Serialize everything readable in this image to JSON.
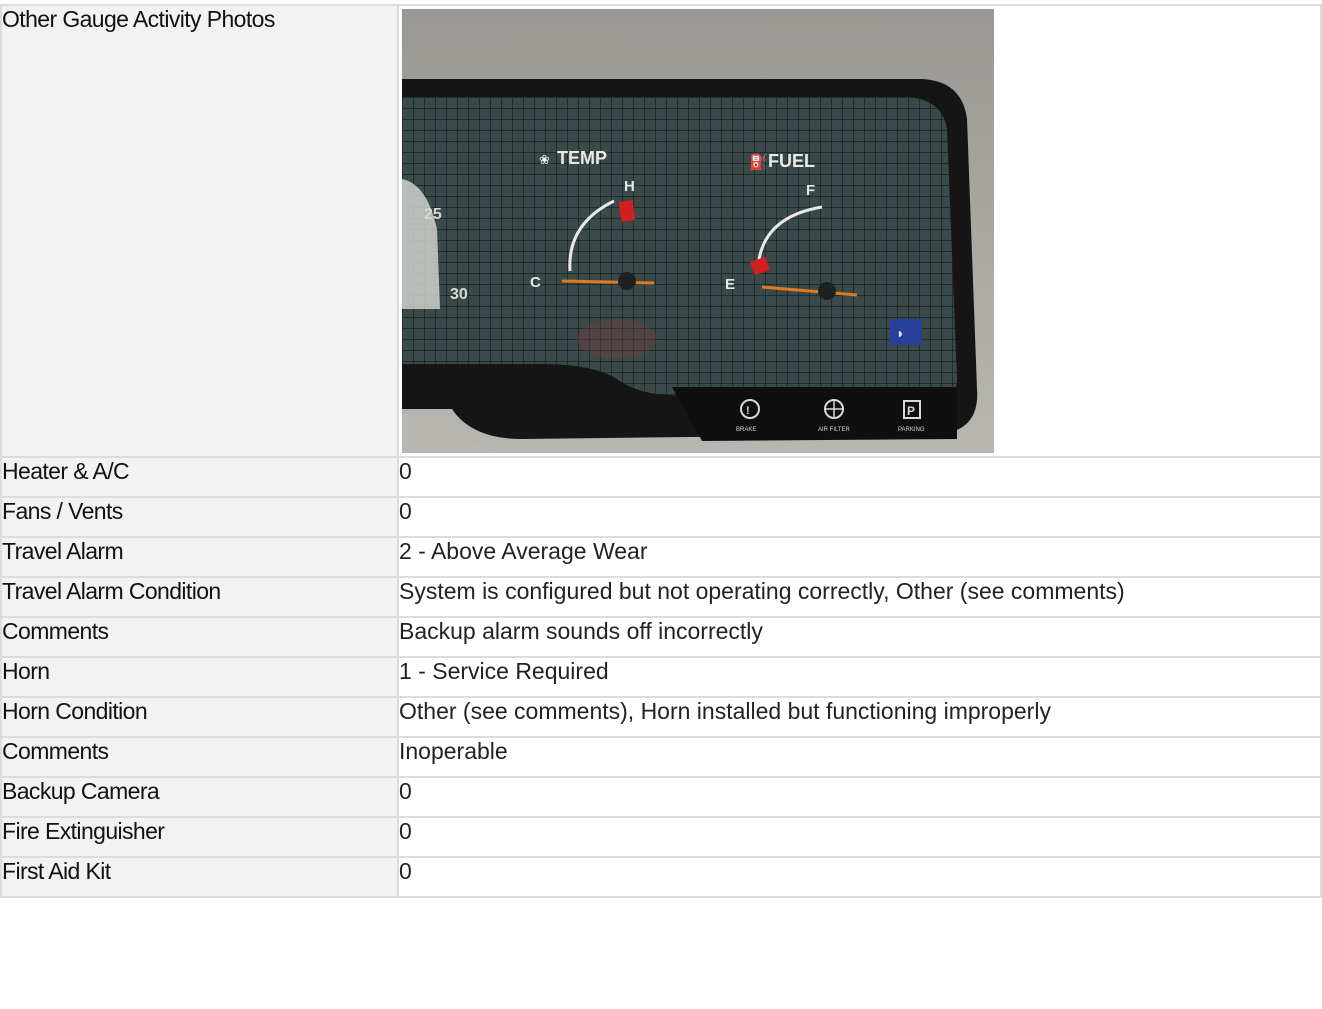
{
  "photo_row": {
    "label": "Other Gauge Activity Photos",
    "photo": {
      "icon_names": [
        "temp-gauge-icon",
        "fuel-gauge-icon",
        "brake-icon",
        "air-filter-icon",
        "parking-icon",
        "high-beam-icon"
      ],
      "speedo_ticks": [
        "25",
        "30"
      ],
      "temp": {
        "title": "TEMP",
        "hot": "H",
        "cold": "C"
      },
      "fuel": {
        "title": "FUEL",
        "full": "F",
        "empty": "E"
      },
      "indicators": [
        "BRAKE",
        "AIR FILTER",
        "PARKING"
      ]
    }
  },
  "rows": [
    {
      "label": "Heater & A/C",
      "value": "0"
    },
    {
      "label": "Fans / Vents",
      "value": "0"
    },
    {
      "label": "Travel Alarm",
      "value": "2 - Above Average Wear"
    },
    {
      "label": "Travel Alarm Condition",
      "value": "System is configured but not operating correctly, Other (see comments)"
    },
    {
      "label": "Comments",
      "value": "Backup alarm sounds off incorrectly"
    },
    {
      "label": "Horn",
      "value": "1 - Service Required"
    },
    {
      "label": "Horn Condition",
      "value": "Other (see comments), Horn installed but functioning improperly"
    },
    {
      "label": "Comments",
      "value": "Inoperable"
    },
    {
      "label": "Backup Camera",
      "value": "0"
    },
    {
      "label": "Fire Extinguisher",
      "value": "0"
    },
    {
      "label": "First Aid Kit",
      "value": "0"
    }
  ]
}
